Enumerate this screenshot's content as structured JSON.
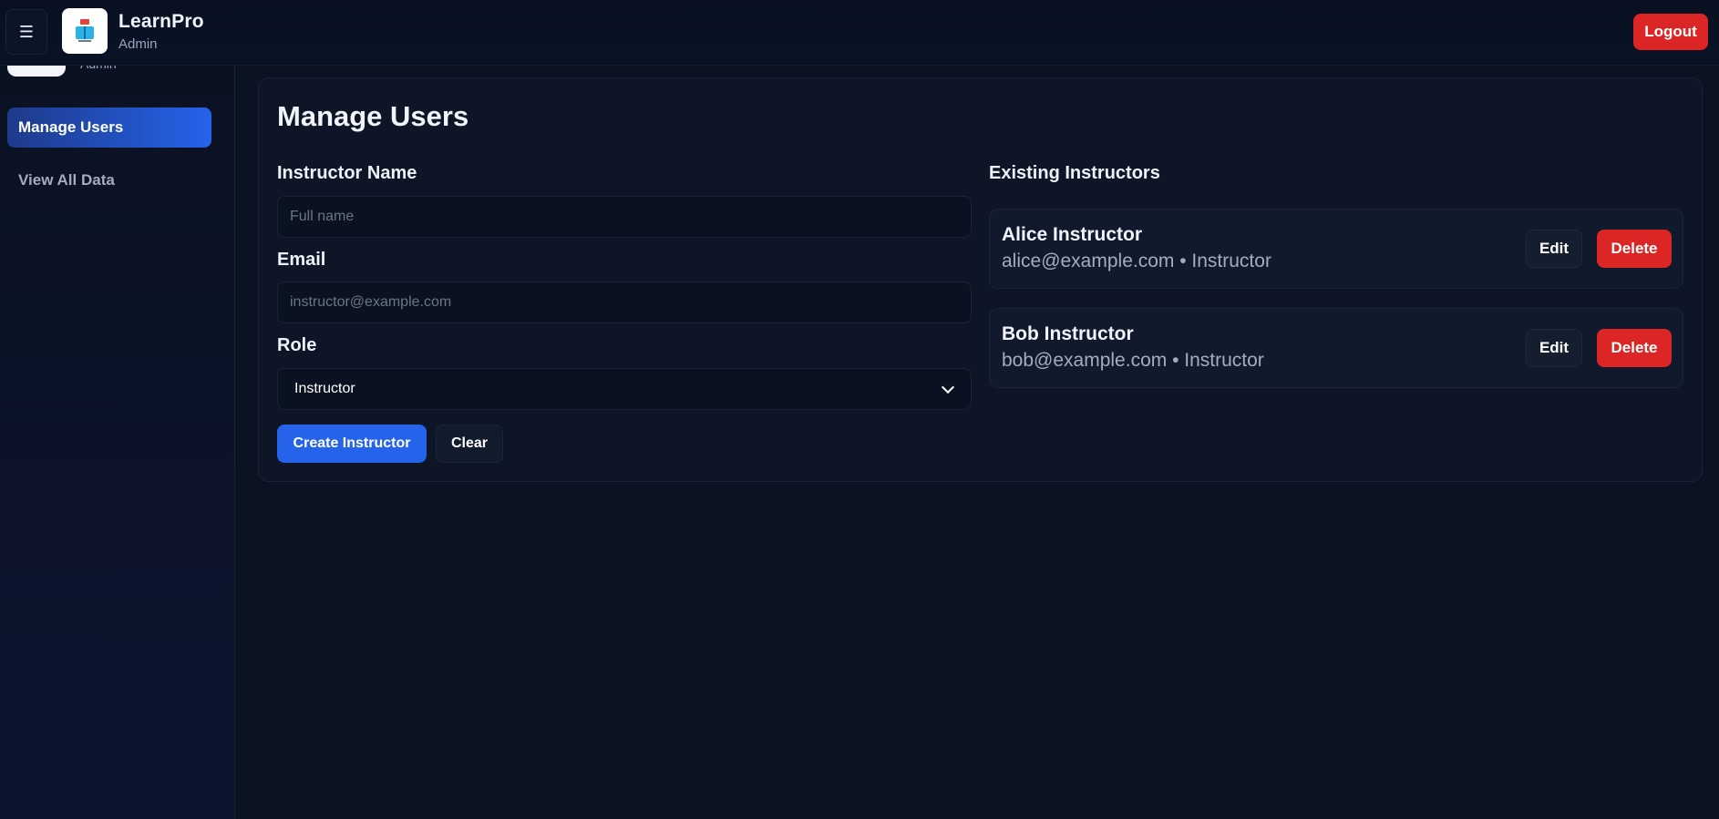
{
  "header": {
    "menu_icon": "☰",
    "brand_title": "LearnPro",
    "brand_subtitle": "Admin",
    "logout_label": "Logout"
  },
  "sidebar": {
    "peek_text": "Admin",
    "items": [
      {
        "label": "Manage Users",
        "active": true
      },
      {
        "label": "View All Data",
        "active": false
      }
    ]
  },
  "main": {
    "title": "Manage Users",
    "form": {
      "name_label": "Instructor Name",
      "name_placeholder": "Full name",
      "email_label": "Email",
      "email_placeholder": "instructor@example.com",
      "role_label": "Role",
      "role_selected": "Instructor",
      "create_label": "Create Instructor",
      "clear_label": "Clear"
    },
    "list": {
      "title": "Existing Instructors",
      "instructors": [
        {
          "name": "Alice Instructor",
          "meta": "alice@example.com • Instructor",
          "edit": "Edit",
          "delete": "Delete"
        },
        {
          "name": "Bob Instructor",
          "meta": "bob@example.com • Instructor",
          "edit": "Edit",
          "delete": "Delete"
        }
      ]
    }
  },
  "colors": {
    "accent": "#2563eb",
    "danger": "#dc2626",
    "background": "#0b1222"
  }
}
